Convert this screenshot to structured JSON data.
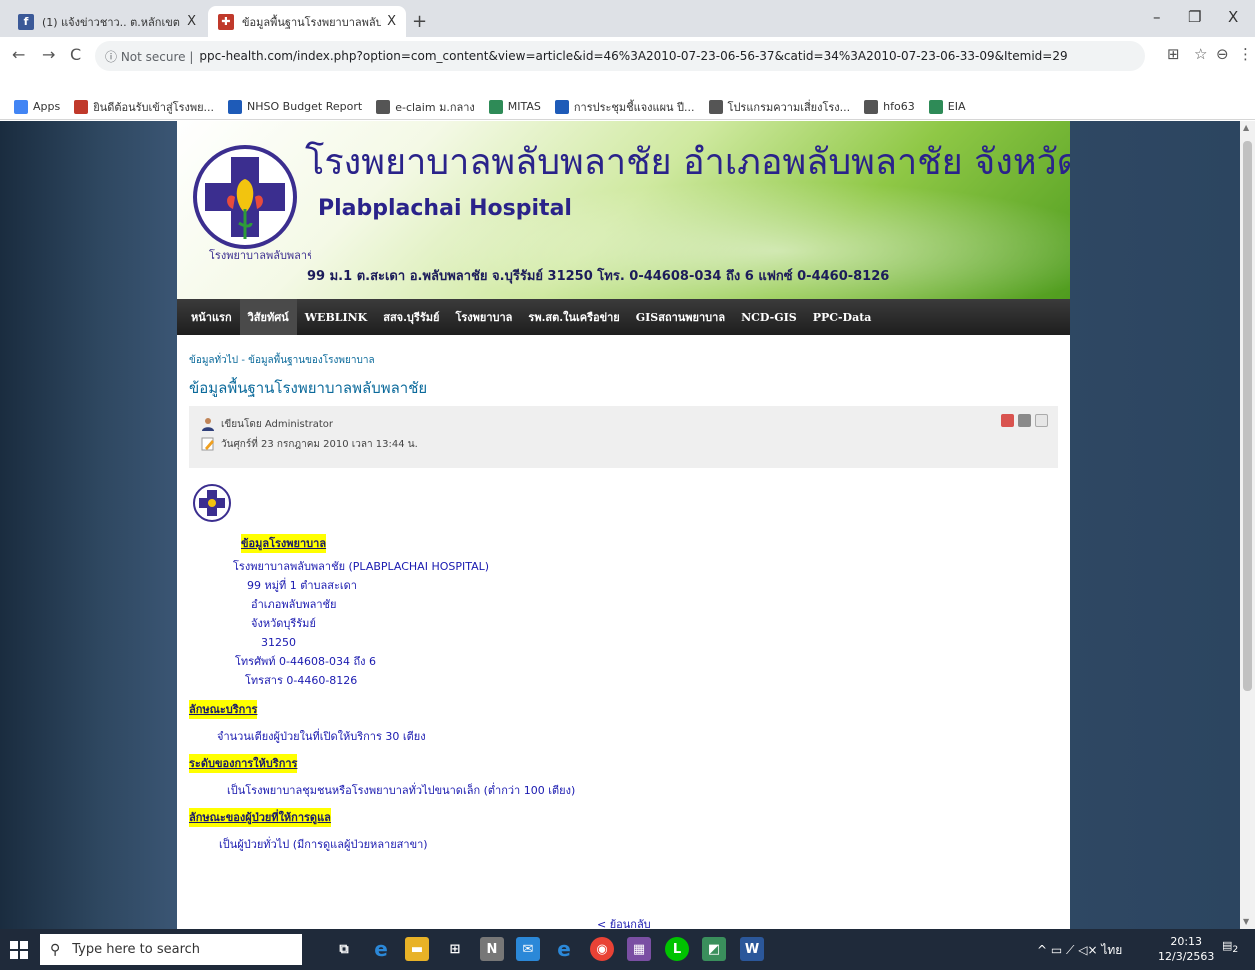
{
  "browser": {
    "tabs": [
      {
        "title": "(1) แจ้งข่าวชาว.. ต.หลักเขต",
        "favicon": "facebook-icon",
        "active": false
      },
      {
        "title": "ข้อมูลพื้นฐานโรงพยาบาลพลับพลาชัย",
        "favicon": "hospital-favicon",
        "active": true
      }
    ],
    "new_tab": "+",
    "close_glyph": "X",
    "win_min": "–",
    "win_max": "❐",
    "win_close": "X",
    "back": "←",
    "forward": "→",
    "reload": "C",
    "security_label": "ⓘ Not secure |",
    "url": "ppc-health.com/index.php?option=com_content&view=article&id=46%3A2010-07-23-06-56-37&catid=34%3A2010-07-23-06-33-09&Itemid=29",
    "translate": "⊞",
    "star": "☆",
    "profile": "⊖",
    "menu": "⋮",
    "bookmarks": [
      {
        "label": "Apps",
        "icon": "apps-grid-icon",
        "color": "#4285f4"
      },
      {
        "label": "ยินดีต้อนรับเข้าสู่โรงพย...",
        "icon": "site-icon",
        "color": "#c0392b"
      },
      {
        "label": "NHSO Budget Report",
        "icon": "nhso-icon",
        "color": "#1e5bb8"
      },
      {
        "label": "e-claim ม.กลาง",
        "icon": "globe-icon",
        "color": "#555555"
      },
      {
        "label": "MITAS",
        "icon": "mitas-icon",
        "color": "#2e8b57"
      },
      {
        "label": "การประชุมชี้แจงแผน ปี...",
        "icon": "calendar-icon",
        "color": "#1e5bb8"
      },
      {
        "label": "โปรแกรมความเสี่ยงโรง...",
        "icon": "globe-icon",
        "color": "#555555"
      },
      {
        "label": "hfo63",
        "icon": "globe-icon",
        "color": "#555555"
      },
      {
        "label": "EIA",
        "icon": "eia-icon",
        "color": "#2e8b57"
      }
    ]
  },
  "banner": {
    "title_th": "โรงพยาบาลพลับพลาชัย อำเภอพลับพลาชัย จังหวัดบุรีรัมย์",
    "title_en": "Plabplachai Hospital",
    "address": "99 ม.1 ต.สะเดา อ.พลับพลาชัย จ.บุรีรัมย์ 31250 โทร. 0-44608-034 ถึง 6 แฟกซ์ 0-4460-8126",
    "logo_text": "โรงพยาบาลพลับพลาชัย"
  },
  "menu": [
    {
      "label": "หน้าแรก",
      "active": false
    },
    {
      "label": "วิสัยทัศน์",
      "active": true
    },
    {
      "label": "WEBLINK",
      "active": false
    },
    {
      "label": "สสจ.บุรีรัมย์",
      "active": false
    },
    {
      "label": "โรงพยาบาล",
      "active": false
    },
    {
      "label": "รพ.สต.ในเครือข่าย",
      "active": false
    },
    {
      "label": "GISสถานพยาบาล",
      "active": false
    },
    {
      "label": "NCD-GIS",
      "active": false
    },
    {
      "label": "PPC-Data",
      "active": false
    }
  ],
  "article": {
    "breadcrumb": "ข้อมูลทั่วไป - ข้อมูลพื้นฐานของโรงพยาบาล",
    "title": "ข้อมูลพื้นฐานโรงพยาบาลพลับพลาชัย",
    "author": "เขียนโดย Administrator",
    "date": "วันศุกร์ที่ 23 กรกฎาคม 2010 เวลา 13:44 น.",
    "section1": "ข้อมูลโรงพยาบาล",
    "lines": [
      "โรงพยาบาลพลับพลาชัย  (PLABPLACHAI HOSPITAL)",
      "99 หมู่ที่ 1 ตำบลสะเดา",
      "อำเภอพลับพลาชัย",
      "จังหวัดบุรีรัมย์",
      "31250",
      "โทรศัพท์ 0-44608-034 ถึง 6",
      "โทรสาร 0-4460-8126"
    ],
    "section2": "ลักษณะบริการ",
    "section2_text": "จำนวนเตียงผู้ป่วยในที่เปิดให้บริการ  30  เตียง",
    "section3": "ระดับของการให้บริการ",
    "section3_text": "เป็นโรงพยาบาลชุมชนหรือโรงพยาบาลทั่วไปขนาดเล็ก (ต่ำกว่า 100 เตียง)",
    "section4": "ลักษณะของผู้ป่วยที่ให้การดูแล",
    "section4_text": "เป็นผู้ป่วยทั่วไป (มีการดูแลผู้ป่วยหลายสาขา)",
    "back_link": "< ย้อนกลับ"
  },
  "taskbar": {
    "search_placeholder": "Type here to search",
    "tray_text": "^ ▭ ⟋ ◁× ไทย",
    "time": "20:13",
    "date": "12/3/2563",
    "notif_count": "2"
  }
}
